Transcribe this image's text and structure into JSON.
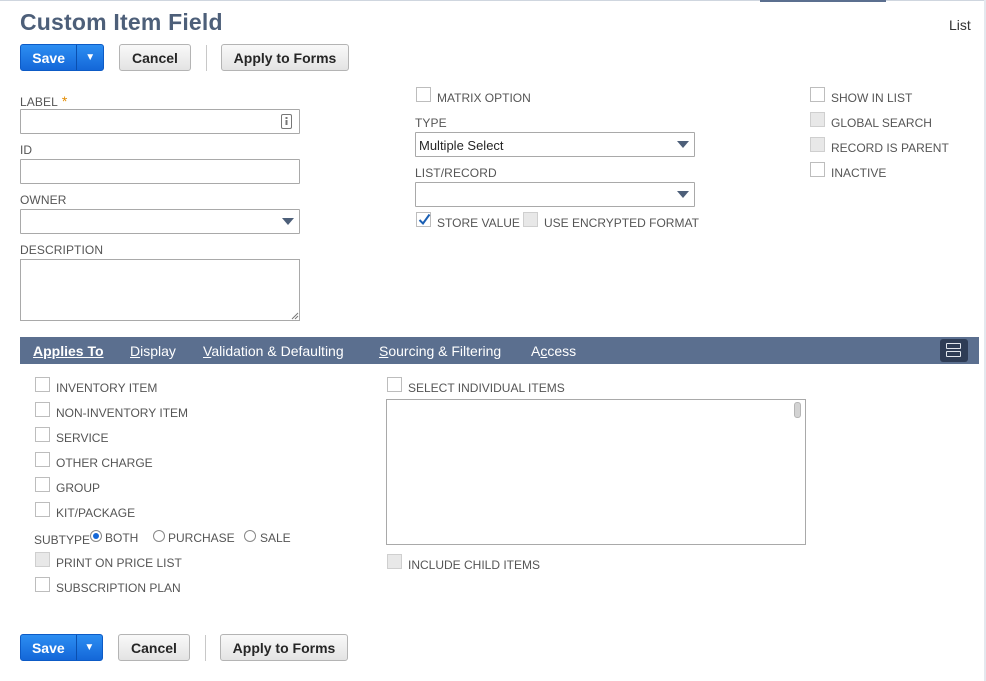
{
  "page": {
    "title": "Custom Item Field",
    "list_link": "List"
  },
  "buttons": {
    "save": "Save",
    "cancel": "Cancel",
    "apply_to_forms": "Apply to Forms",
    "menu_arrow": "▼"
  },
  "fields": {
    "label": {
      "label": "LABEL",
      "required_marker": "*",
      "value": ""
    },
    "id": {
      "label": "ID",
      "value": ""
    },
    "owner": {
      "label": "OWNER",
      "value": ""
    },
    "description": {
      "label": "DESCRIPTION",
      "value": ""
    },
    "type": {
      "label": "TYPE",
      "value": "Multiple Select"
    },
    "list_record": {
      "label": "LIST/RECORD",
      "value": ""
    }
  },
  "checkboxes": {
    "matrix_option": {
      "label": "MATRIX OPTION",
      "checked": false
    },
    "store_value": {
      "label": "STORE VALUE",
      "checked": true
    },
    "use_encrypted_format": {
      "label": "USE ENCRYPTED FORMAT",
      "checked": false,
      "disabled": true
    },
    "show_in_list": {
      "label": "SHOW IN LIST",
      "checked": false
    },
    "global_search": {
      "label": "GLOBAL SEARCH",
      "checked": false,
      "disabled": true
    },
    "record_is_parent": {
      "label": "RECORD IS PARENT",
      "checked": false,
      "disabled": true
    },
    "inactive": {
      "label": "INACTIVE",
      "checked": false
    }
  },
  "tabs": [
    {
      "first": "A",
      "rest": "pplies To",
      "active": true
    },
    {
      "first": "D",
      "rest": "isplay",
      "active": false
    },
    {
      "first": "V",
      "rest": "alidation & Defaulting",
      "active": false
    },
    {
      "first": "S",
      "rest": "ourcing & Filtering",
      "active": false
    },
    {
      "pre": "A",
      "first": "c",
      "rest": "cess",
      "active": false
    }
  ],
  "applies_to": {
    "inventory_item": "INVENTORY ITEM",
    "non_inventory_item": "NON-INVENTORY ITEM",
    "service": "SERVICE",
    "other_charge": "OTHER CHARGE",
    "group": "GROUP",
    "kit_package": "KIT/PACKAGE",
    "subtype_label": "SUBTYPE",
    "subtype_options": [
      "BOTH",
      "PURCHASE",
      "SALE"
    ],
    "subtype_selected": "BOTH",
    "print_on_price_list": "PRINT ON PRICE LIST",
    "subscription_plan": "SUBSCRIPTION PLAN",
    "select_individual_items": "SELECT INDIVIDUAL ITEMS",
    "include_child_items": "INCLUDE CHILD ITEMS"
  }
}
